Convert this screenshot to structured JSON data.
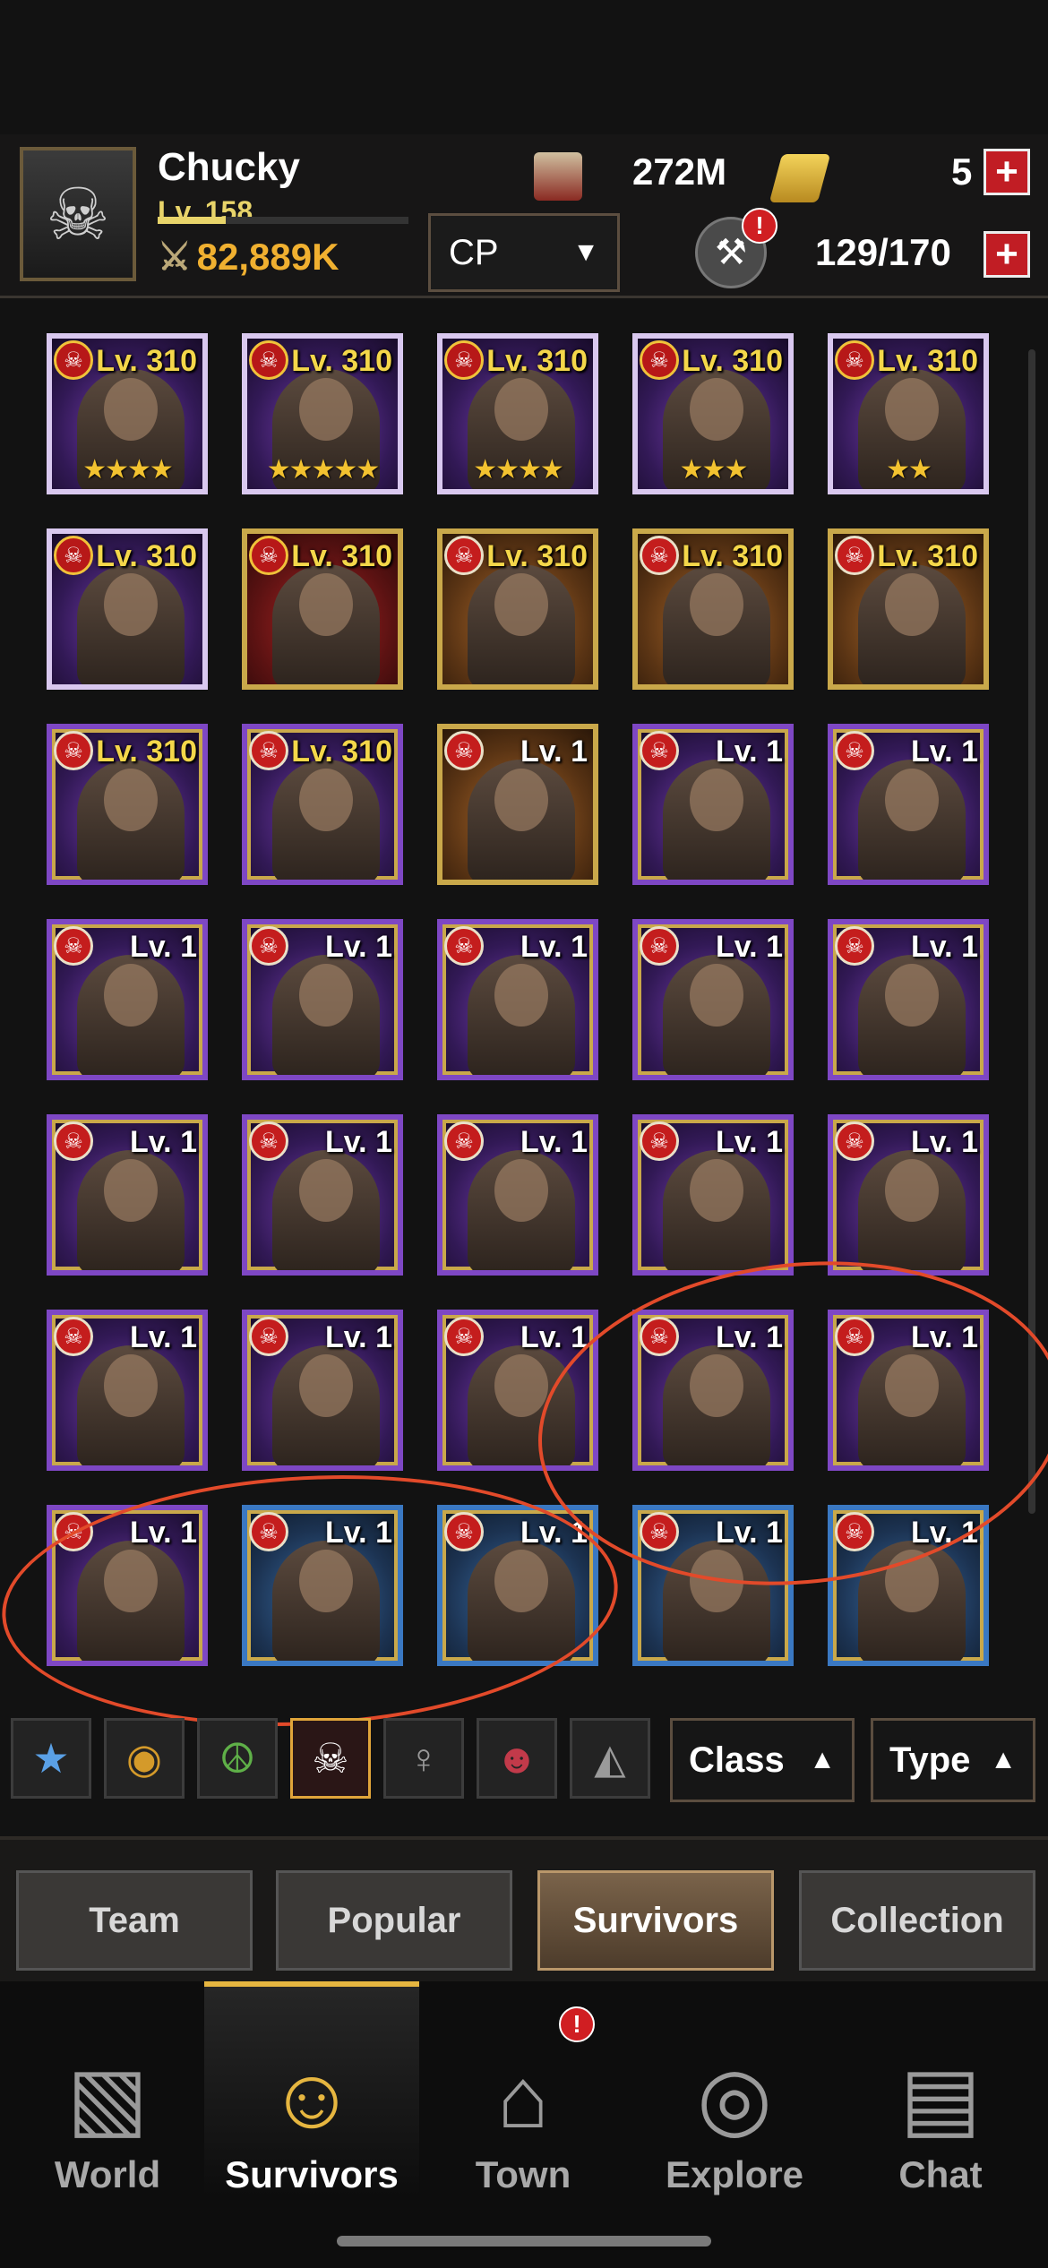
{
  "player": {
    "name": "Chucky",
    "level": "Lv. 158",
    "xp_progress_percent": 27,
    "combat_power": "82,889K"
  },
  "resources": {
    "cash": "272M",
    "gold": "5",
    "roster": "129/170"
  },
  "sort_select": {
    "value": "CP"
  },
  "survivors": [
    {
      "level": "Lv. 310",
      "stars": "★★★★",
      "frame": "lilac",
      "bg": "purple",
      "crest": "gold"
    },
    {
      "level": "Lv. 310",
      "stars": "★★★★★",
      "frame": "lilac",
      "bg": "purple",
      "crest": "gold"
    },
    {
      "level": "Lv. 310",
      "stars": "★★★★",
      "frame": "lilac",
      "bg": "purple",
      "crest": "gold"
    },
    {
      "level": "Lv. 310",
      "stars": "★★★",
      "frame": "lilac",
      "bg": "purple",
      "crest": "gold"
    },
    {
      "level": "Lv. 310",
      "stars": "★★",
      "frame": "lilac",
      "bg": "purple",
      "crest": "gold"
    },
    {
      "level": "Lv. 310",
      "stars": "",
      "frame": "lilac",
      "bg": "purple",
      "crest": "gold"
    },
    {
      "level": "Lv. 310",
      "stars": "",
      "frame": "gold",
      "bg": "red",
      "crest": "gold"
    },
    {
      "level": "Lv. 310",
      "stars": "",
      "frame": "gold",
      "bg": "orange",
      "crest": "red"
    },
    {
      "level": "Lv. 310",
      "stars": "",
      "frame": "gold",
      "bg": "orange",
      "crest": "red"
    },
    {
      "level": "Lv. 310",
      "stars": "",
      "frame": "gold",
      "bg": "orange",
      "crest": "red"
    },
    {
      "level": "Lv. 310",
      "stars": "",
      "frame": "frame-purple",
      "bg": "purple",
      "crest": "red"
    },
    {
      "level": "Lv. 310",
      "stars": "",
      "frame": "frame-purple",
      "bg": "purple",
      "crest": "red"
    },
    {
      "level": "Lv. 1",
      "stars": "",
      "frame": "gold",
      "bg": "orange",
      "crest": "red"
    },
    {
      "level": "Lv. 1",
      "stars": "",
      "frame": "frame-purple",
      "bg": "purple",
      "crest": "red"
    },
    {
      "level": "Lv. 1",
      "stars": "",
      "frame": "frame-purple",
      "bg": "purple",
      "crest": "red"
    },
    {
      "level": "Lv. 1",
      "stars": "",
      "frame": "frame-purple",
      "bg": "purple",
      "crest": "red"
    },
    {
      "level": "Lv. 1",
      "stars": "",
      "frame": "frame-purple",
      "bg": "purple",
      "crest": "red"
    },
    {
      "level": "Lv. 1",
      "stars": "",
      "frame": "frame-purple",
      "bg": "purple",
      "crest": "red"
    },
    {
      "level": "Lv. 1",
      "stars": "",
      "frame": "frame-purple",
      "bg": "purple",
      "crest": "red"
    },
    {
      "level": "Lv. 1",
      "stars": "",
      "frame": "frame-purple",
      "bg": "purple",
      "crest": "red"
    },
    {
      "level": "Lv. 1",
      "stars": "",
      "frame": "frame-purple",
      "bg": "purple",
      "crest": "red"
    },
    {
      "level": "Lv. 1",
      "stars": "",
      "frame": "frame-purple",
      "bg": "purple",
      "crest": "red"
    },
    {
      "level": "Lv. 1",
      "stars": "",
      "frame": "frame-purple",
      "bg": "purple",
      "crest": "red"
    },
    {
      "level": "Lv. 1",
      "stars": "",
      "frame": "frame-purple",
      "bg": "purple",
      "crest": "red"
    },
    {
      "level": "Lv. 1",
      "stars": "",
      "frame": "frame-purple",
      "bg": "purple",
      "crest": "red"
    },
    {
      "level": "Lv. 1",
      "stars": "",
      "frame": "frame-purple",
      "bg": "purple",
      "crest": "red"
    },
    {
      "level": "Lv. 1",
      "stars": "",
      "frame": "frame-purple",
      "bg": "purple",
      "crest": "red"
    },
    {
      "level": "Lv. 1",
      "stars": "",
      "frame": "frame-purple",
      "bg": "purple",
      "crest": "red"
    },
    {
      "level": "Lv. 1",
      "stars": "",
      "frame": "frame-purple",
      "bg": "purple",
      "crest": "red"
    },
    {
      "level": "Lv. 1",
      "stars": "",
      "frame": "frame-purple",
      "bg": "purple",
      "crest": "red"
    },
    {
      "level": "Lv. 1",
      "stars": "",
      "frame": "frame-purple",
      "bg": "purple",
      "crest": "red"
    },
    {
      "level": "Lv. 1",
      "stars": "",
      "frame": "frame-blue",
      "bg": "blue",
      "crest": "red"
    },
    {
      "level": "Lv. 1",
      "stars": "",
      "frame": "frame-blue",
      "bg": "blue",
      "crest": "red"
    },
    {
      "level": "Lv. 1",
      "stars": "",
      "frame": "frame-blue",
      "bg": "blue",
      "crest": "red"
    },
    {
      "level": "Lv. 1",
      "stars": "",
      "frame": "frame-blue",
      "bg": "blue",
      "crest": "red"
    }
  ],
  "filters": {
    "faction_icons": [
      "star-faction-icon",
      "beast-faction-icon",
      "peace-faction-icon",
      "skull-faction-icon",
      "woman-faction-icon",
      "bandana-faction-icon",
      "hood-faction-icon"
    ],
    "active_index": 3,
    "class_label": "Class",
    "type_label": "Type"
  },
  "tabs": [
    "Team",
    "Popular",
    "Survivors",
    "Collection"
  ],
  "active_tab": "Survivors",
  "nav": [
    {
      "label": "World",
      "icon": "map-icon"
    },
    {
      "label": "Survivors",
      "icon": "survivor-portrait-icon"
    },
    {
      "label": "Town",
      "icon": "town-hall-icon",
      "badge": "!"
    },
    {
      "label": "Explore",
      "icon": "binoculars-icon"
    },
    {
      "label": "Chat",
      "icon": "radio-icon"
    }
  ],
  "active_nav": "Survivors",
  "colors": {
    "accent_gold": "#e6b640",
    "alert_red": "#d01e22",
    "annotation": "#e24a2a"
  },
  "alert_badge": "!"
}
